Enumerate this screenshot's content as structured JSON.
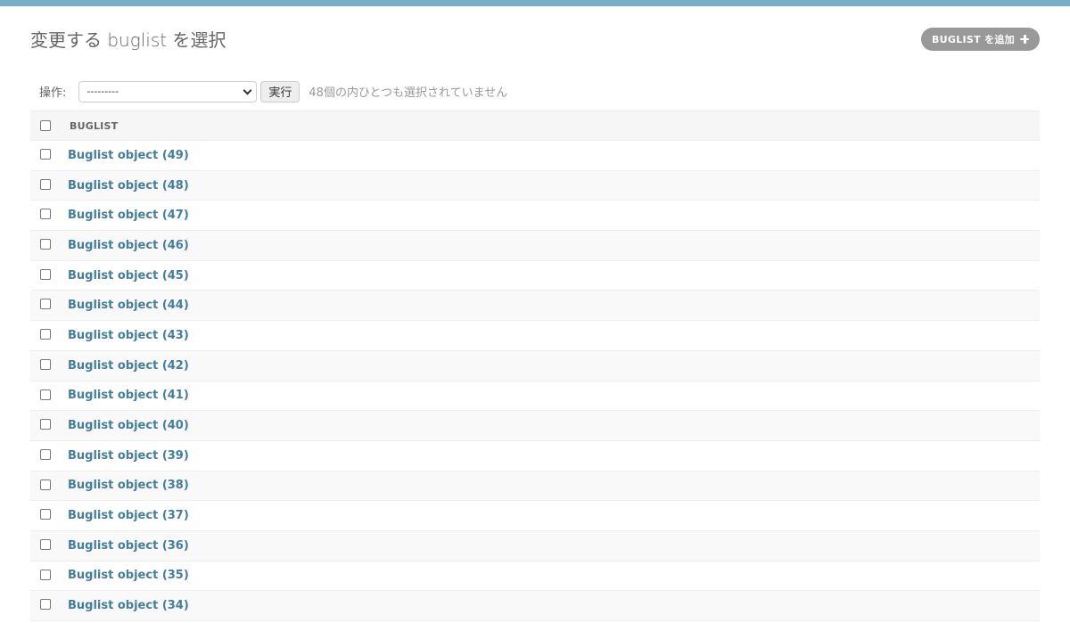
{
  "colors": {
    "top_bar": "#79aec8",
    "link": "#447e9b",
    "add_button_bg": "#999999",
    "row_alt_bg": "#f9f9f9",
    "header_bg": "#f6f6f6"
  },
  "header": {
    "title": "変更する buglist を選択",
    "add_button_label": "BUGLIST を追加",
    "add_button_icon": "plus-icon"
  },
  "actions": {
    "label": "操作:",
    "select_value": "---------",
    "select_icon": "chevron-down-icon",
    "run_label": "実行",
    "selection_count": "48個の内ひとつも選択されていません"
  },
  "table": {
    "column_header": "BUGLIST",
    "rows": [
      "Buglist object (49)",
      "Buglist object (48)",
      "Buglist object (47)",
      "Buglist object (46)",
      "Buglist object (45)",
      "Buglist object (44)",
      "Buglist object (43)",
      "Buglist object (42)",
      "Buglist object (41)",
      "Buglist object (40)",
      "Buglist object (39)",
      "Buglist object (38)",
      "Buglist object (37)",
      "Buglist object (36)",
      "Buglist object (35)",
      "Buglist object (34)"
    ]
  }
}
